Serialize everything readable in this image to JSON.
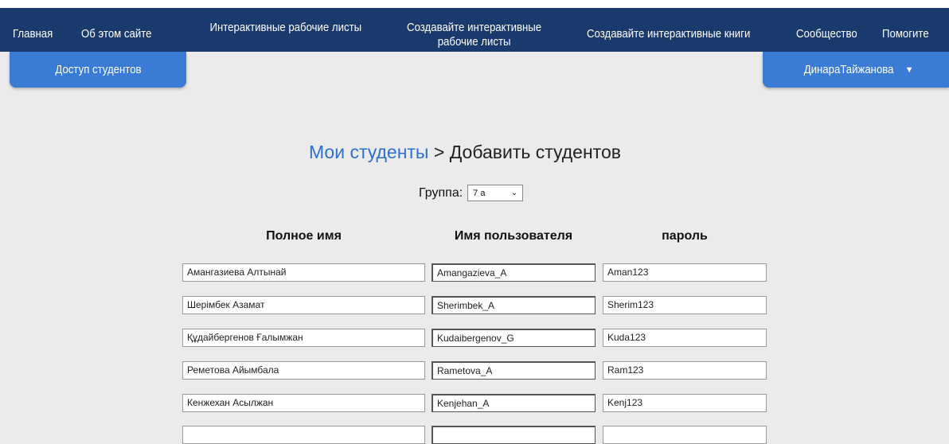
{
  "nav": {
    "items": [
      {
        "id": "home",
        "label": "Главная"
      },
      {
        "id": "about",
        "label": "Об этом сайте"
      },
      {
        "id": "worksheets",
        "label": "Интерактивные рабочие листы"
      },
      {
        "id": "create-worksheets",
        "label": "Создавайте интерактивные рабочие листы"
      },
      {
        "id": "create-books",
        "label": "Создавайте интерактивные книги"
      },
      {
        "id": "community",
        "label": "Сообщество"
      },
      {
        "id": "help",
        "label": "Помогите"
      }
    ]
  },
  "tabs": {
    "student_access": "Доступ студентов",
    "user_name": "ДинараТайжанова"
  },
  "breadcrumb": {
    "link": "Мои студенты",
    "separator": ">",
    "current": "Добавить студентов"
  },
  "group": {
    "label": "Группа:",
    "selected": "7 а"
  },
  "columns": {
    "full_name": "Полное имя",
    "username": "Имя пользователя",
    "password": "пароль"
  },
  "students": [
    {
      "full_name": "Амангазиева Алтынай",
      "username": "Amangazieva_A",
      "password": "Aman123"
    },
    {
      "full_name": "Шерімбек Азамат",
      "username": "Sherimbek_A",
      "password": "Sherim123"
    },
    {
      "full_name": "Құдайбергенов Ғалымжан",
      "username": "Kudaibergenov_G",
      "password": "Kuda123"
    },
    {
      "full_name": "Реметова Айымбала",
      "username": "Rametova_A",
      "password": "Ram123"
    },
    {
      "full_name": "Кенжехан Асылжан",
      "username": "Kenjehan_A",
      "password": "Kenj123"
    },
    {
      "full_name": "",
      "username": "",
      "password": ""
    }
  ],
  "colors": {
    "navbar": "#1a3a6e",
    "tab": "#3a7bd5",
    "link": "#2e6fd3",
    "background": "#ebebeb"
  }
}
